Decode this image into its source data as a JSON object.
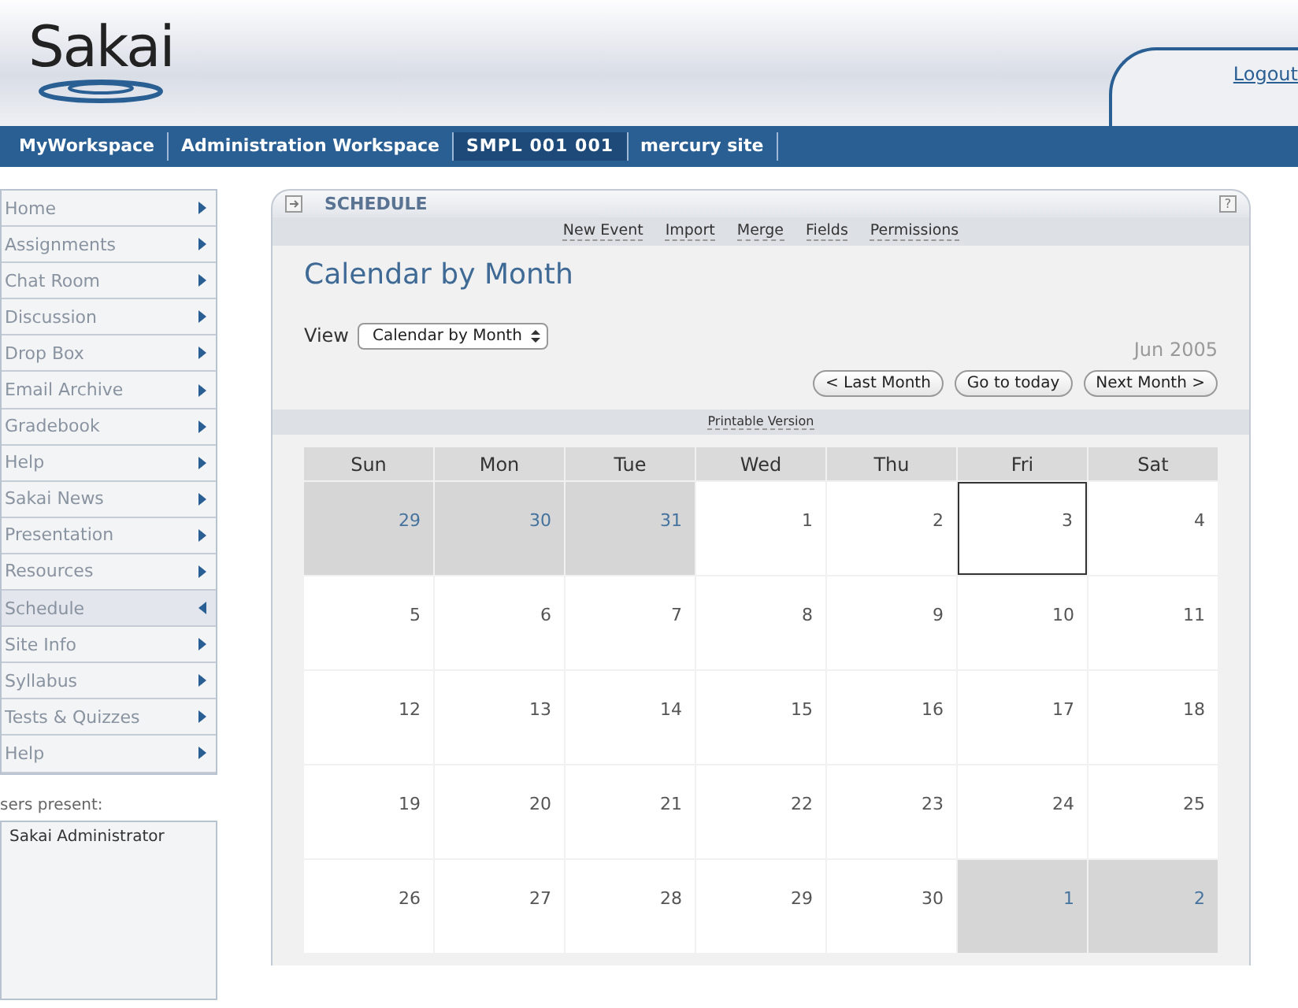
{
  "header": {
    "logo": "Sakai",
    "logout": "Logout"
  },
  "site_tabs": [
    {
      "label": "MyWorkspace",
      "selected": false
    },
    {
      "label": "Administration Workspace",
      "selected": false
    },
    {
      "label": "SMPL 001 001",
      "selected": true
    },
    {
      "label": "mercury site",
      "selected": false
    }
  ],
  "sidebar": {
    "items": [
      {
        "label": "Home",
        "selected": false
      },
      {
        "label": "Assignments",
        "selected": false
      },
      {
        "label": "Chat Room",
        "selected": false
      },
      {
        "label": "Discussion",
        "selected": false
      },
      {
        "label": "Drop Box",
        "selected": false
      },
      {
        "label": "Email Archive",
        "selected": false
      },
      {
        "label": "Gradebook",
        "selected": false
      },
      {
        "label": "Help",
        "selected": false
      },
      {
        "label": "Sakai News",
        "selected": false
      },
      {
        "label": "Presentation",
        "selected": false
      },
      {
        "label": "Resources",
        "selected": false
      },
      {
        "label": "Schedule",
        "selected": true
      },
      {
        "label": "Site Info",
        "selected": false
      },
      {
        "label": "Syllabus",
        "selected": false
      },
      {
        "label": "Tests & Quizzes",
        "selected": false
      },
      {
        "label": "Help",
        "selected": false
      }
    ],
    "presence_label": "sers present:",
    "users": [
      "Sakai Administrator"
    ]
  },
  "tool": {
    "title": "SCHEDULE",
    "help": "?",
    "actions": [
      "New Event",
      "Import",
      "Merge",
      "Fields",
      "Permissions"
    ],
    "heading": "Calendar by Month",
    "view_label": "View",
    "view_value": "Calendar by Month",
    "month": "Jun 2005",
    "buttons": [
      "< Last Month",
      "Go to today",
      "Next Month >"
    ],
    "printable": "Printable Version",
    "weekdays": [
      "Sun",
      "Mon",
      "Tue",
      "Wed",
      "Thu",
      "Fri",
      "Sat"
    ],
    "weeks": [
      [
        {
          "day": "29",
          "in_month": false,
          "today": false
        },
        {
          "day": "30",
          "in_month": false,
          "today": false
        },
        {
          "day": "31",
          "in_month": false,
          "today": false
        },
        {
          "day": "1",
          "in_month": true,
          "today": false
        },
        {
          "day": "2",
          "in_month": true,
          "today": false
        },
        {
          "day": "3",
          "in_month": true,
          "today": true
        },
        {
          "day": "4",
          "in_month": true,
          "today": false
        }
      ],
      [
        {
          "day": "5",
          "in_month": true,
          "today": false
        },
        {
          "day": "6",
          "in_month": true,
          "today": false
        },
        {
          "day": "7",
          "in_month": true,
          "today": false
        },
        {
          "day": "8",
          "in_month": true,
          "today": false
        },
        {
          "day": "9",
          "in_month": true,
          "today": false
        },
        {
          "day": "10",
          "in_month": true,
          "today": false
        },
        {
          "day": "11",
          "in_month": true,
          "today": false
        }
      ],
      [
        {
          "day": "12",
          "in_month": true,
          "today": false
        },
        {
          "day": "13",
          "in_month": true,
          "today": false
        },
        {
          "day": "14",
          "in_month": true,
          "today": false
        },
        {
          "day": "15",
          "in_month": true,
          "today": false
        },
        {
          "day": "16",
          "in_month": true,
          "today": false
        },
        {
          "day": "17",
          "in_month": true,
          "today": false
        },
        {
          "day": "18",
          "in_month": true,
          "today": false
        }
      ],
      [
        {
          "day": "19",
          "in_month": true,
          "today": false
        },
        {
          "day": "20",
          "in_month": true,
          "today": false
        },
        {
          "day": "21",
          "in_month": true,
          "today": false
        },
        {
          "day": "22",
          "in_month": true,
          "today": false
        },
        {
          "day": "23",
          "in_month": true,
          "today": false
        },
        {
          "day": "24",
          "in_month": true,
          "today": false
        },
        {
          "day": "25",
          "in_month": true,
          "today": false
        }
      ],
      [
        {
          "day": "26",
          "in_month": true,
          "today": false
        },
        {
          "day": "27",
          "in_month": true,
          "today": false
        },
        {
          "day": "28",
          "in_month": true,
          "today": false
        },
        {
          "day": "29",
          "in_month": true,
          "today": false
        },
        {
          "day": "30",
          "in_month": true,
          "today": false
        },
        {
          "day": "1",
          "in_month": false,
          "today": false
        },
        {
          "day": "2",
          "in_month": false,
          "today": false
        }
      ]
    ]
  }
}
